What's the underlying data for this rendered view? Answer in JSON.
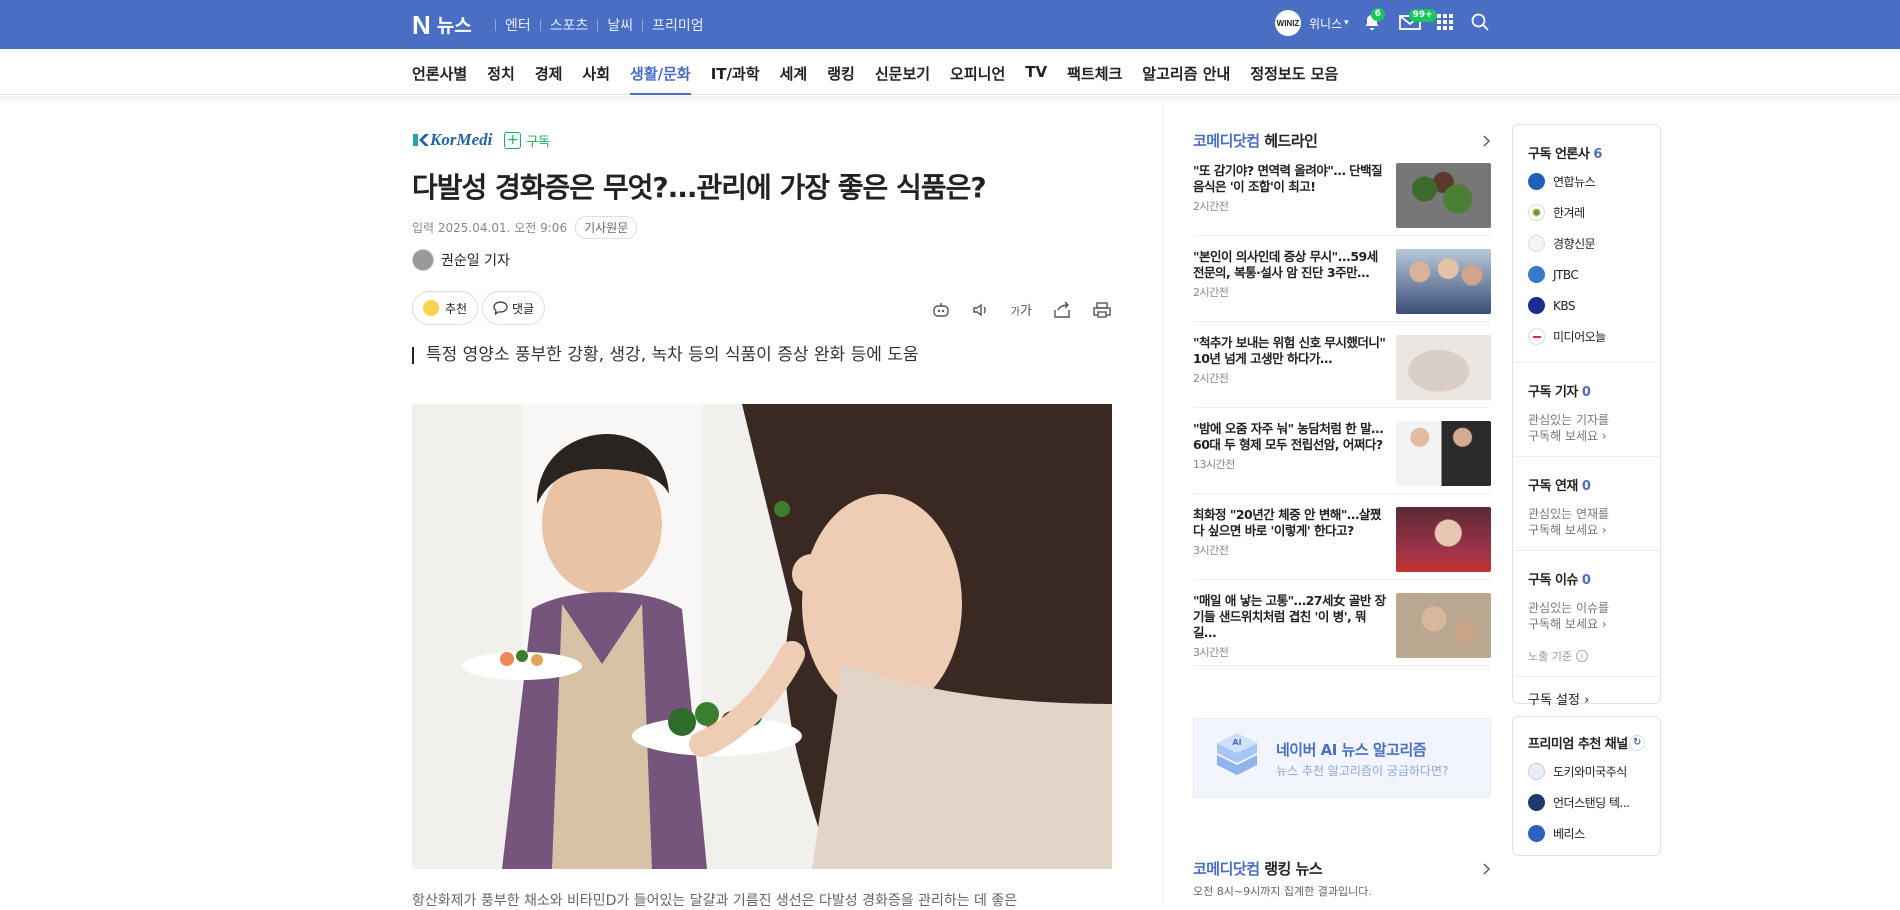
{
  "colors": {
    "brand": "#4a6ec4",
    "subscribe": "#17b35a"
  },
  "top": {
    "logo_mark": "N",
    "logo_text": "뉴스",
    "services": [
      "엔터",
      "스포츠",
      "날씨",
      "프리미엄"
    ],
    "user": {
      "avatar_text": "WINIZ",
      "name": "위니스",
      "notif_count": "6",
      "mail_count": "99+"
    }
  },
  "gnb": [
    "언론사별",
    "정치",
    "경제",
    "사회",
    "생활/문화",
    "IT/과학",
    "세계",
    "랭킹",
    "신문보기",
    "오피니언",
    "TV",
    "팩트체크",
    "알고리즘 안내",
    "정정보도 모음"
  ],
  "gnb_active": "생활/문화",
  "article": {
    "press": "KorMedi",
    "subscribe": "구독",
    "title": "다발성 경화증은 무엇?...관리에 가장 좋은 식품은?",
    "date": "입력 2025.04.01. 오전 9:06",
    "original": "기사원문",
    "reporter": "권순일 기자",
    "like": "추천",
    "comment": "댓글",
    "font_size": "가",
    "summary": "특정 영양소 풍부한 강황, 생강, 녹차 등의 식품이 증상 완화 등에 도움",
    "caption": "항산화제가 풍부한 채소와 비타민D가 들어있는 달걀과 기름진 생선은 다발성 경화증을 관리하는 데 좋은"
  },
  "headline": {
    "press": "코메디닷컴",
    "label": "헤드라인",
    "items": [
      {
        "title": "\"또 감기야? 면역력 올려야\"… 단백질 음식은 '이 조합'이 최고!",
        "time": "2시간전"
      },
      {
        "title": "\"본인이 의사인데 증상 무시\"...59세 전문의, 복통·설사 암 진단 3주만…",
        "time": "2시간전"
      },
      {
        "title": "\"척추가 보내는 위험 신호 무시했더니\" 10년 넘게 고생만 하다가…",
        "time": "2시간전"
      },
      {
        "title": "\"밤에 오줌 자주 눠\" 농담처럼 한 말…60대 두 형제 모두 전립선암, 어쩌다?",
        "time": "13시간전"
      },
      {
        "title": "최화정 \"20년간 체중 안 변해\"…살쪘다 싶으면 바로 '이렇게' 한다고?",
        "time": "3시간전"
      },
      {
        "title": "\"매일 애 낳는 고통\"…27세女 골반 장기들 샌드위치처럼 겹친 '이 병', 뭐길…",
        "time": "3시간전"
      }
    ]
  },
  "ai_banner": {
    "title": "네이버 AI 뉴스 알고리즘",
    "sub": "뉴스 추천 알고리즘이 궁금하다면?",
    "badge": "AI"
  },
  "ranking": {
    "press": "코메디닷컴",
    "label": "랭킹 뉴스",
    "sub": "오전 8시~9시까지 집계한 결과입니다."
  },
  "subscribe": {
    "press_label": "구독 언론사",
    "press_count": "6",
    "presses": [
      "연합뉴스",
      "한겨레",
      "경향신문",
      "JTBC",
      "KBS",
      "미디어오늘"
    ],
    "reporter_label": "구독 기자",
    "reporter_count": "0",
    "reporter_hint": "관심있는 기자를 구독해 보세요",
    "series_label": "구독 연재",
    "series_count": "0",
    "series_hint": "관심있는 연재를 구독해 보세요",
    "issue_label": "구독 이슈",
    "issue_count": "0",
    "issue_hint": "관심있는 이슈를 구독해 보세요",
    "exposure": "노출 기준",
    "settings": "구독 설정"
  },
  "premium": {
    "label": "프리미엄 추천 채널",
    "channels": [
      "도키와미국주식",
      "언더스탠딩 텍...",
      "베리스"
    ]
  }
}
